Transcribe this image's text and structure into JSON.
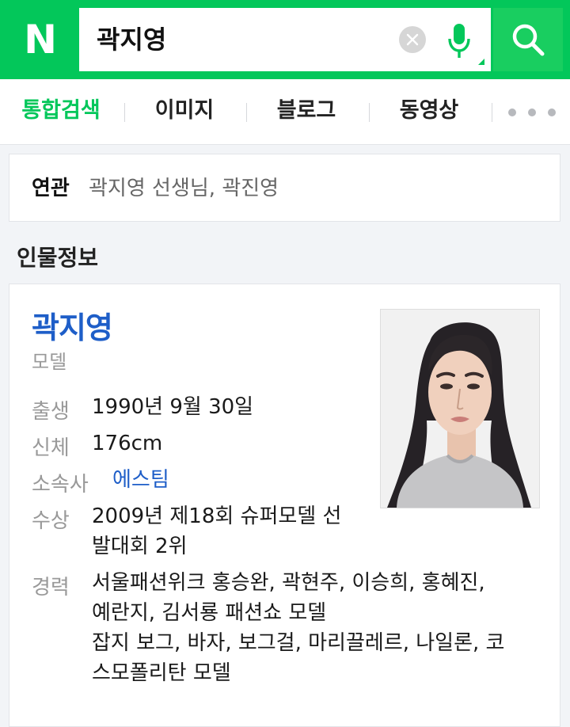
{
  "header": {
    "logo": "N",
    "search_query": "곽지영",
    "icons": {
      "clear": "clear-x-icon",
      "mic": "microphone-icon",
      "search": "search-icon"
    },
    "brand_color": "#03c75a"
  },
  "tabs": [
    {
      "label": "통합검색",
      "active": true
    },
    {
      "label": "이미지",
      "active": false
    },
    {
      "label": "블로그",
      "active": false
    },
    {
      "label": "동영상",
      "active": false
    }
  ],
  "related": {
    "label": "연관",
    "items": "곽지영 선생님, 곽진영"
  },
  "section_title": "인물정보",
  "profile": {
    "name": "곽지영",
    "job": "모델",
    "info": {
      "birth_label": "출생",
      "birth_value": "1990년 9월 30일",
      "body_label": "신체",
      "body_value": "176cm",
      "agency_label": "소속사",
      "agency_value": "에스팀",
      "award_label": "수상",
      "award_line1": "2009년 제18회 슈퍼모델 선",
      "award_line2": "발대회 2위",
      "career_label": "경력",
      "career_line1": "서울패션위크 홍승완, 곽현주, 이승희, 홍혜진,",
      "career_line2": "예란지, 김서룡 패션쇼 모델",
      "career_line3": "잡지 보그, 바자, 보그걸, 마리끌레르, 나일론, 코",
      "career_line4": "스모폴리탄 모델"
    }
  }
}
